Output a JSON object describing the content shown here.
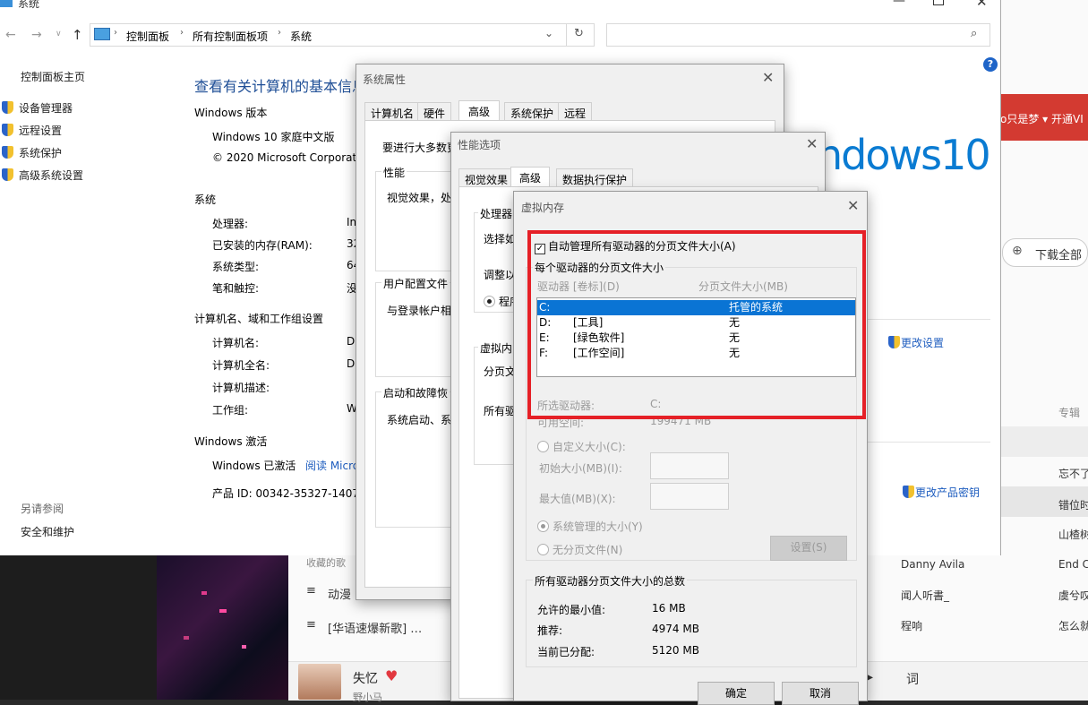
{
  "music_app": {
    "top_user_text": "o只是梦 ▾ 开通VI",
    "download_all": "下载全部",
    "album_header": "专辑",
    "rows": [
      {
        "album": "忘不了"
      },
      {
        "album": "错位时"
      },
      {
        "album": "山楂树"
      },
      {
        "artist": "Danny Avila",
        "album": "End C"
      },
      {
        "title": "动漫",
        "artist": "闻人听書_",
        "album": "虞兮叹"
      },
      {
        "title": "[华语速爆新歌] …",
        "artist": "程响",
        "album": "怎么就"
      },
      {
        "artist": "",
        "album": ""
      }
    ],
    "partial_left_text": "收藏的歌",
    "now_playing": {
      "title": "失忆",
      "artist": "野小马"
    },
    "lyrics_btn": "词"
  },
  "system_window": {
    "title": "系统",
    "address": [
      "控制面板",
      "所有控制面板项",
      "系统"
    ],
    "sidebar": {
      "home": "控制面板主页",
      "links": [
        "设备管理器",
        "远程设置",
        "系统保护",
        "高级系统设置"
      ],
      "see_also_label": "另请参阅",
      "see_also": "安全和维护"
    },
    "heading": "查看有关计算机的基本信息",
    "edition": {
      "section": "Windows 版本",
      "name": "Windows 10 家庭中文版",
      "copyright": "© 2020 Microsoft Corporat"
    },
    "logo": "ndows10",
    "system": {
      "section": "系统",
      "rows": [
        {
          "k": "处理器:",
          "v": "In"
        },
        {
          "k": "已安装的内存(RAM):",
          "v": "32"
        },
        {
          "k": "系统类型:",
          "v": "64"
        },
        {
          "k": "笔和触控:",
          "v": "没"
        }
      ]
    },
    "computer": {
      "section": "计算机名、域和工作组设置",
      "rows": [
        {
          "k": "计算机名:",
          "v": "D"
        },
        {
          "k": "计算机全名:",
          "v": "D"
        },
        {
          "k": "计算机描述:",
          "v": ""
        },
        {
          "k": "工作组:",
          "v": "W"
        }
      ],
      "change_settings": "更改设置"
    },
    "activation": {
      "section": "Windows 激活",
      "status": "Windows 已激活",
      "read_link": "阅读 Micro",
      "product_id": "产品 ID: 00342-35327-1407",
      "change_key": "更改产品密钥"
    }
  },
  "sys_props": {
    "title": "系统属性",
    "tabs": [
      "计算机名",
      "硬件",
      "高级",
      "系统保护",
      "远程"
    ],
    "intro": "要进行大多数更",
    "perf_label": "性能",
    "perf_text": "视觉效果，处",
    "profile_label": "用户配置文件",
    "profile_text": "与登录帐户相",
    "startup_label": "启动和故障恢",
    "startup_text": "系统启动、系"
  },
  "perf_options": {
    "title": "性能选项",
    "tabs": [
      "视觉效果",
      "高级",
      "数据执行保护"
    ],
    "cpu_label": "处理器",
    "cpu_text": "选择如",
    "adjust": "调整以",
    "program": "程序",
    "vm_label": "虚拟内",
    "vm_text1": "分页文",
    "vm_text2": "所有驱"
  },
  "vm_dialog": {
    "title": "虚拟内存",
    "auto_manage": "自动管理所有驱动器的分页文件大小(A)",
    "per_drive_label": "每个驱动器的分页文件大小",
    "col_drive": "驱动器 [卷标](D)",
    "col_size": "分页文件大小(MB)",
    "drives": [
      {
        "drive": "C:",
        "label": "",
        "size": "托管的系统"
      },
      {
        "drive": "D:",
        "label": "[工具]",
        "size": "无"
      },
      {
        "drive": "E:",
        "label": "[绿色软件]",
        "size": "无"
      },
      {
        "drive": "F:",
        "label": "[工作空间]",
        "size": "无"
      }
    ],
    "selected_drive_label": "所选驱动器:",
    "selected_drive": "C:",
    "free_space_label": "可用空间:",
    "free_space": "199471 MB",
    "custom_size": "自定义大小(C):",
    "initial_size": "初始大小(MB)(I):",
    "max_size": "最大值(MB)(X):",
    "system_managed": "系统管理的大小(Y)",
    "no_paging": "无分页文件(N)",
    "set_btn": "设置(S)",
    "totals_label": "所有驱动器分页文件大小的总数",
    "min_allowed_label": "允许的最小值:",
    "min_allowed": "16 MB",
    "recommended_label": "推荐:",
    "recommended": "4974 MB",
    "allocated_label": "当前已分配:",
    "allocated": "5120 MB",
    "ok": "确定",
    "cancel": "取消"
  }
}
